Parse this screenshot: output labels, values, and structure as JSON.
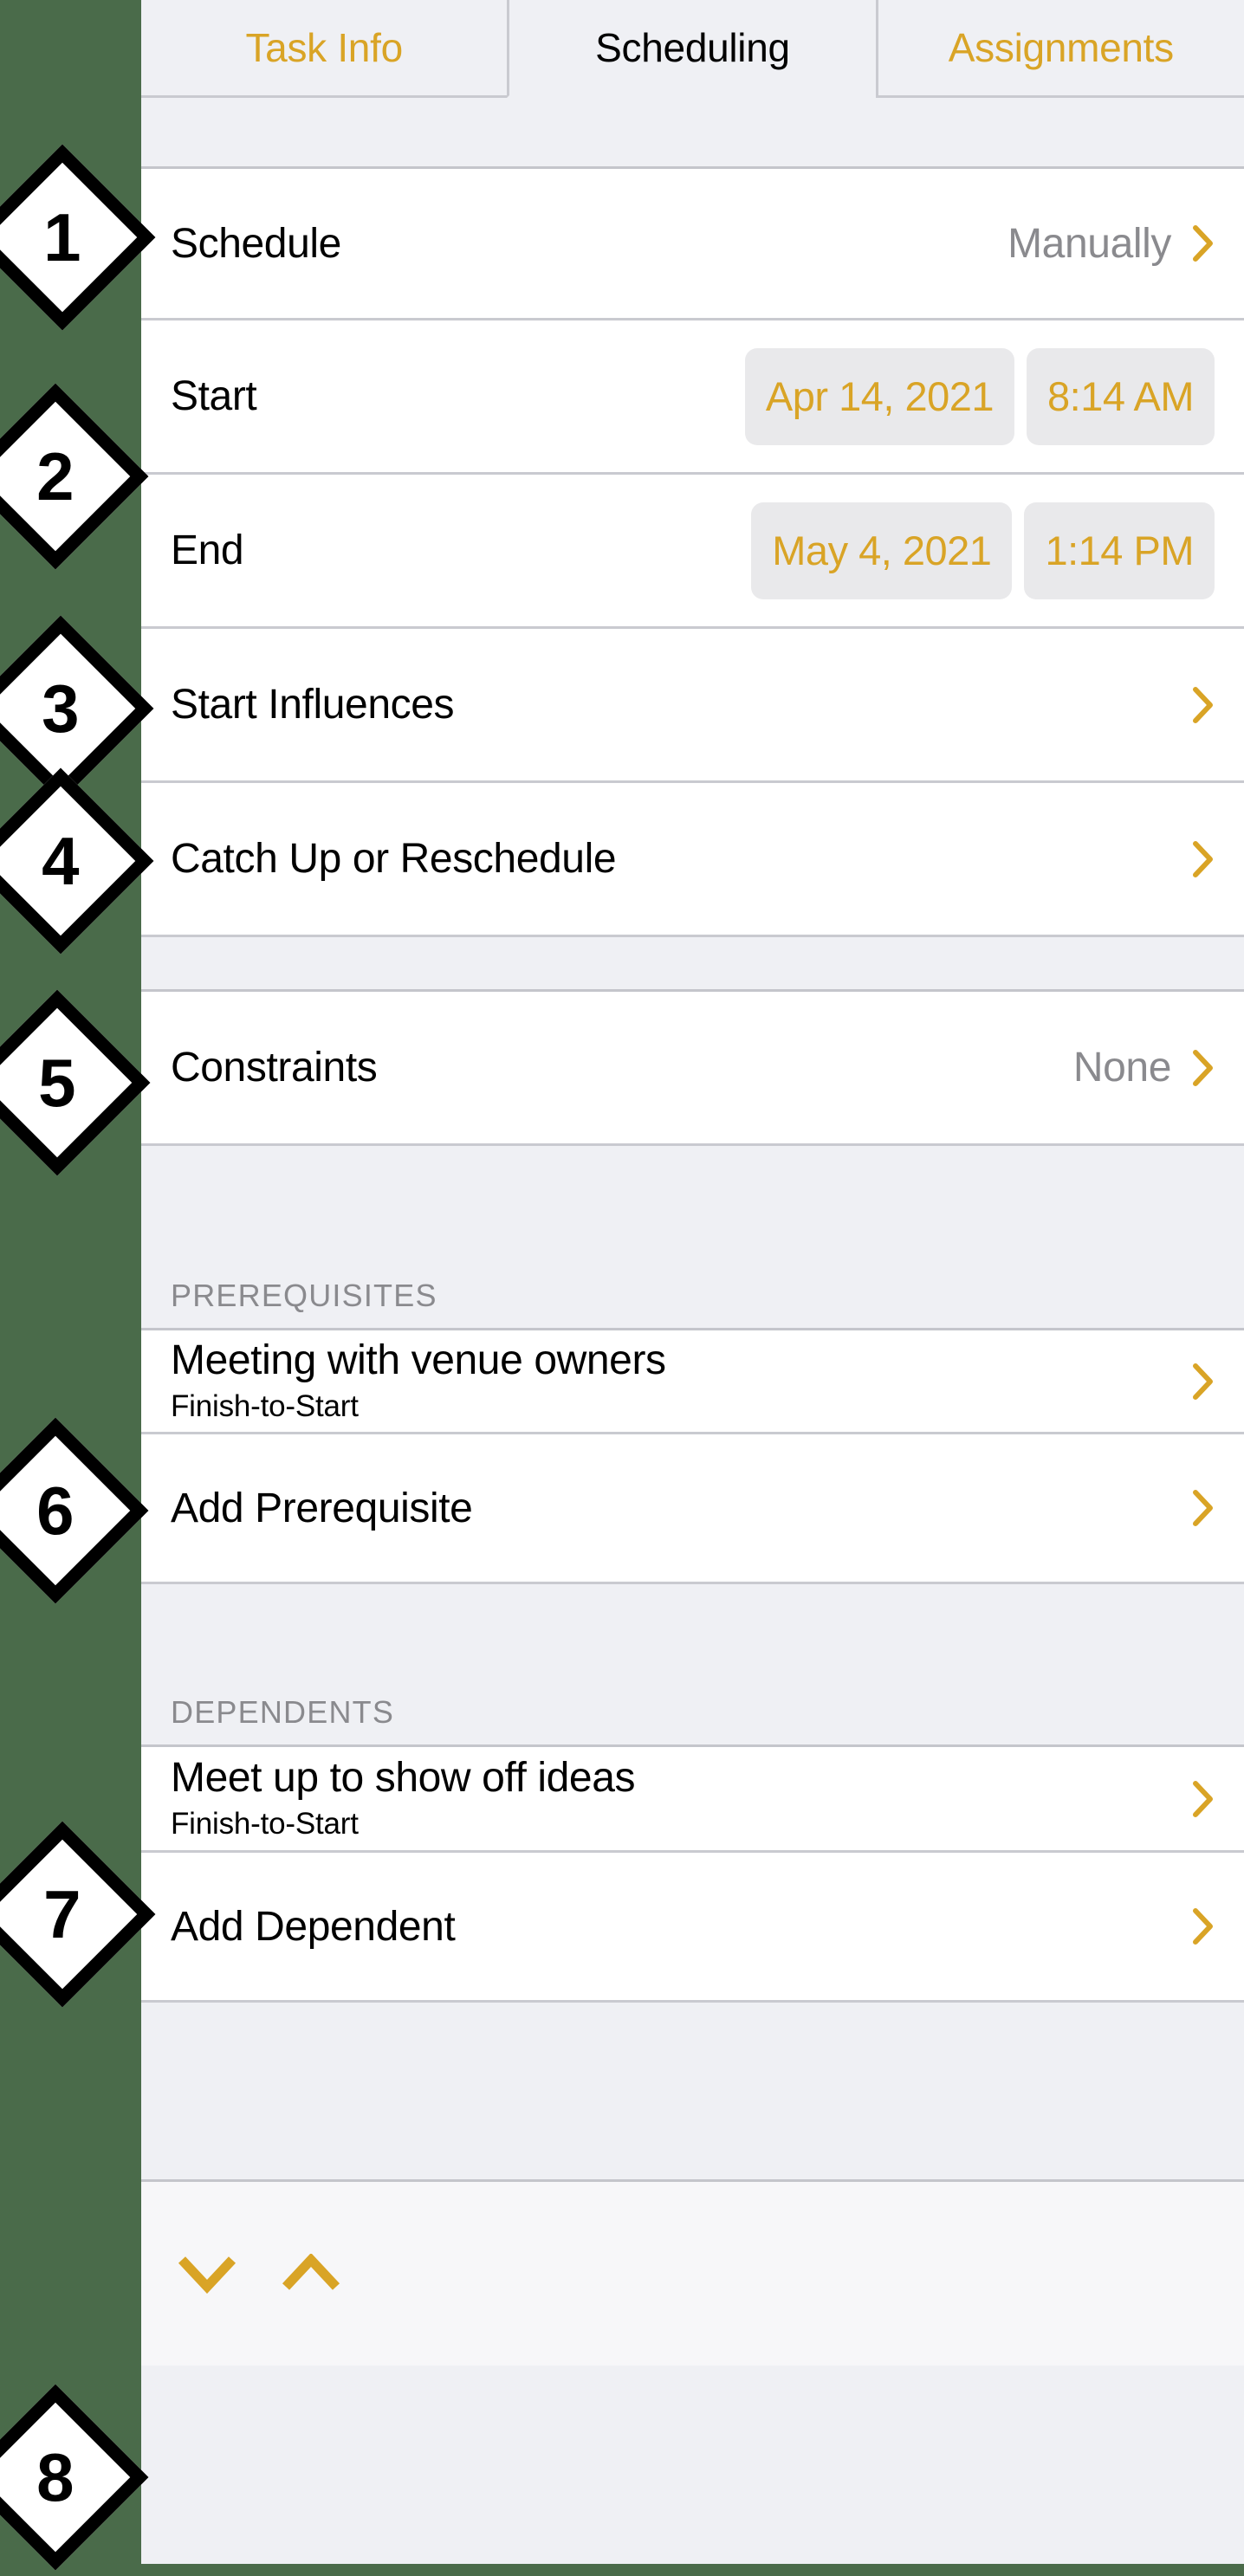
{
  "tabs": [
    {
      "label": "Task Info",
      "selected": false
    },
    {
      "label": "Scheduling",
      "selected": true
    },
    {
      "label": "Assignments",
      "selected": false
    }
  ],
  "rows": {
    "schedule": {
      "label": "Schedule",
      "value": "Manually"
    },
    "start": {
      "label": "Start",
      "date": "Apr 14, 2021",
      "time": "8:14 AM"
    },
    "end": {
      "label": "End",
      "date": "May 4, 2021",
      "time": "1:14 PM"
    },
    "start_influences": {
      "label": "Start Influences"
    },
    "catch_up": {
      "label": "Catch Up or Reschedule"
    },
    "constraints": {
      "label": "Constraints",
      "value": "None"
    }
  },
  "prerequisites": {
    "header": "PREREQUISITES",
    "items": [
      {
        "title": "Meeting with venue owners",
        "subtitle": "Finish-to-Start"
      }
    ],
    "add_label": "Add Prerequisite"
  },
  "dependents": {
    "header": "DEPENDENTS",
    "items": [
      {
        "title": "Meet up to show off ideas",
        "subtitle": "Finish-to-Start"
      }
    ],
    "add_label": "Add Dependent"
  },
  "toolbar": {
    "previous_icon": "chevron-down-icon",
    "next_icon": "chevron-up-icon"
  },
  "annotations": [
    {
      "number": "1"
    },
    {
      "number": "2"
    },
    {
      "number": "3"
    },
    {
      "number": "4"
    },
    {
      "number": "5"
    },
    {
      "number": "6"
    },
    {
      "number": "7"
    },
    {
      "number": "8"
    }
  ],
  "colors": {
    "accent": "#d9a426",
    "background": "#4a6b4a",
    "panel": "#eff0f4",
    "row": "#ffffff",
    "muted_text": "#8a8a8e",
    "separator": "#c9cad0",
    "pill": "#e9e9eb"
  }
}
